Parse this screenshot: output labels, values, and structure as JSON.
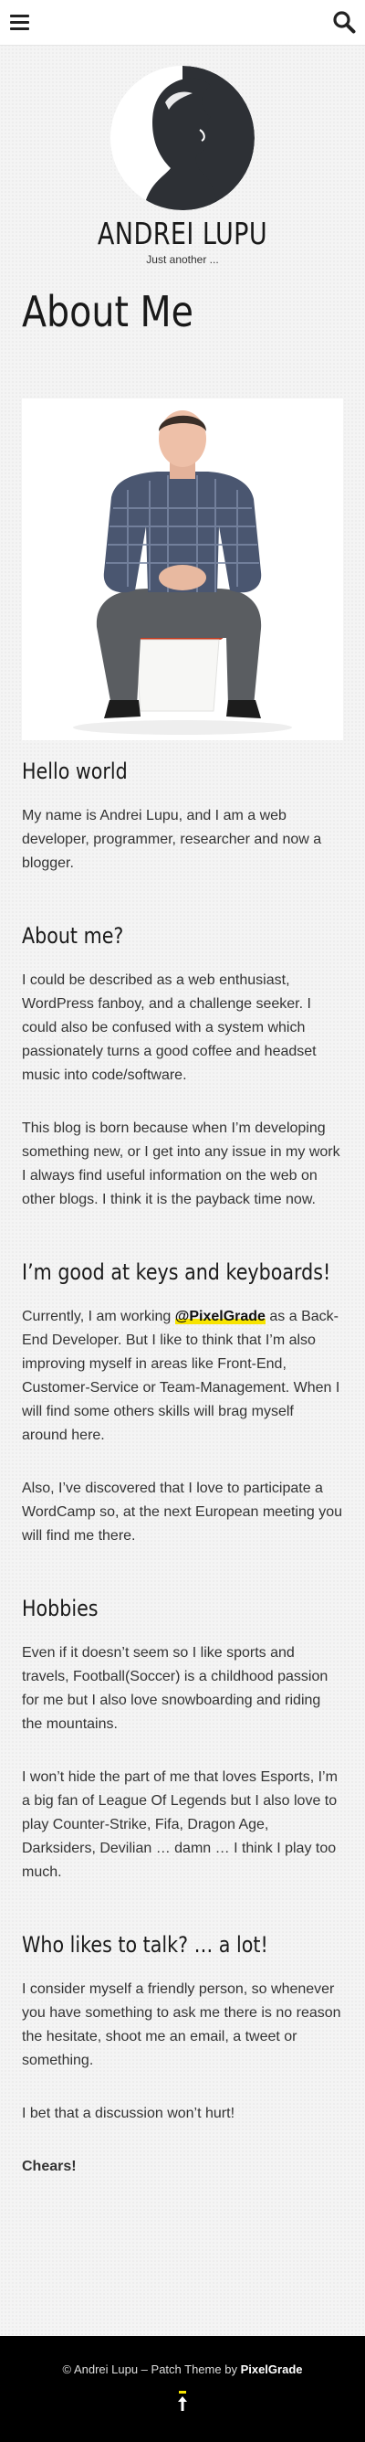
{
  "header": {
    "menu_icon": "menu-icon",
    "search_icon": "search-icon"
  },
  "site": {
    "title": "ANDREI LUPU",
    "tagline": "Just another ..."
  },
  "page": {
    "title": "About Me"
  },
  "sections": {
    "hello": {
      "heading": "Hello world",
      "p1": "My name is Andrei Lupu, and I am a web developer, programmer, researcher and now a blogger."
    },
    "about": {
      "heading": "About me?",
      "p1": "I could be described as a web enthusiast, WordPress fanboy, and a challenge seeker. I could also be confused with a system which passionately turns a good coffee and headset music into code/software.",
      "p2": "This blog is born because when I’m developing something new, or I get into any issue in my work I always find useful information on the web on other blogs. I think it is the payback time now."
    },
    "keys": {
      "heading": "I’m good at keys and keyboards!",
      "p1_before": "Currently, I am working ",
      "p1_mention": "@PixelGrade",
      "p1_after": " as a Back-End Developer. But I like to think that I’m also improving myself in areas like Front-End, Customer-Service or Team-Management. When I will find some others skills will brag myself around here.",
      "p2": "Also, I’ve discovered that I love to participate a WordCamp so, at the next European meeting you will find me there."
    },
    "hobbies": {
      "heading": "Hobbies",
      "p1": "Even if it doesn’t seem so I like sports and travels, Football(Soccer) is a childhood passion for me but I also love snowboarding and riding the mountains.",
      "p2": "I won’t hide the part of me that loves Esports, I’m a big fan of League Of Legends but I also love to play Counter-Strike, Fifa, Dragon Age, Darksiders, Devilian … damn … I think I play too much."
    },
    "talk": {
      "heading": "Who likes to talk? … a lot!",
      "p1": "I consider myself a friendly person, so whenever you have something to ask me there is no reason the hesitate, shoot me an email, a tweet or something.",
      "p2": "I bet that a discussion won’t hurt!",
      "p3": "Chears!"
    }
  },
  "footer": {
    "text": "© Andrei Lupu – Patch Theme by ",
    "link": "PixelGrade",
    "totop_icon": "arrow-up-icon"
  },
  "colors": {
    "accent_highlight": "#f7e400",
    "footer_bg": "#000000",
    "logo_dark": "#2d3035"
  }
}
